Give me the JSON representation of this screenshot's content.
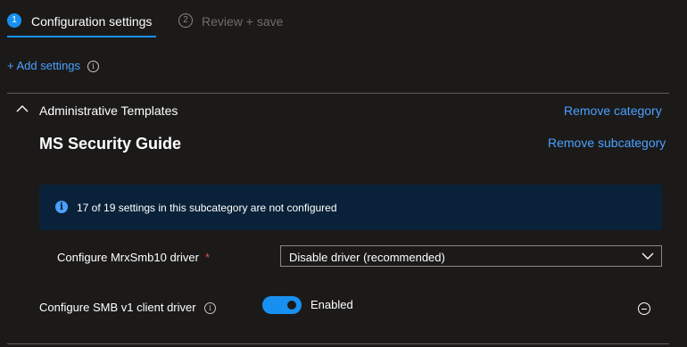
{
  "wizard": {
    "steps": [
      {
        "number": "1",
        "label": "Configuration settings"
      },
      {
        "number": "2",
        "label": "Review + save"
      }
    ]
  },
  "toolbar": {
    "add_settings_label": "+ Add settings"
  },
  "category": {
    "title": "Administrative Templates",
    "remove_category_label": "Remove category"
  },
  "subcategory": {
    "title": "MS Security Guide",
    "remove_subcategory_label": "Remove subcategory"
  },
  "banner": {
    "message": "17 of 19 settings in this subcategory are not configured"
  },
  "settings": [
    {
      "label": "Configure MrxSmb10 driver",
      "required_mark": "*",
      "selected_value": "Disable driver (recommended)"
    },
    {
      "label": "Configure SMB v1 client driver",
      "toggle_state": "Enabled"
    }
  ],
  "colors": {
    "accent": "#1890f1",
    "link": "#4ba0ff",
    "background": "#1b1a19",
    "banner": "#0a2239",
    "required": "#e8534e"
  }
}
